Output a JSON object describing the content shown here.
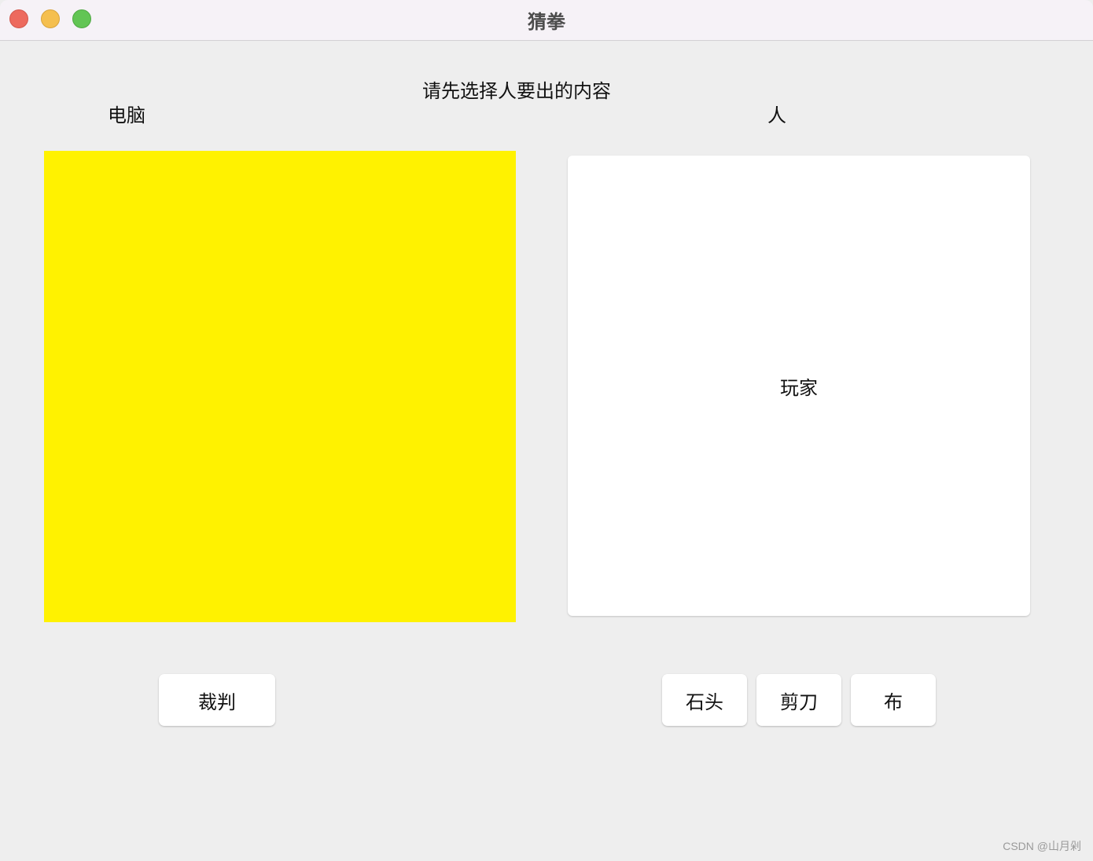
{
  "window": {
    "title": "猜拳"
  },
  "instruction": "请先选择人要出的内容",
  "computer": {
    "label": "电脑",
    "panel_color": "#fff200"
  },
  "person": {
    "label": "人",
    "panel_text": "玩家"
  },
  "buttons": {
    "judge": "裁判",
    "rock": "石头",
    "scissors": "剪刀",
    "paper": "布"
  },
  "watermark": "CSDN @山月剁"
}
